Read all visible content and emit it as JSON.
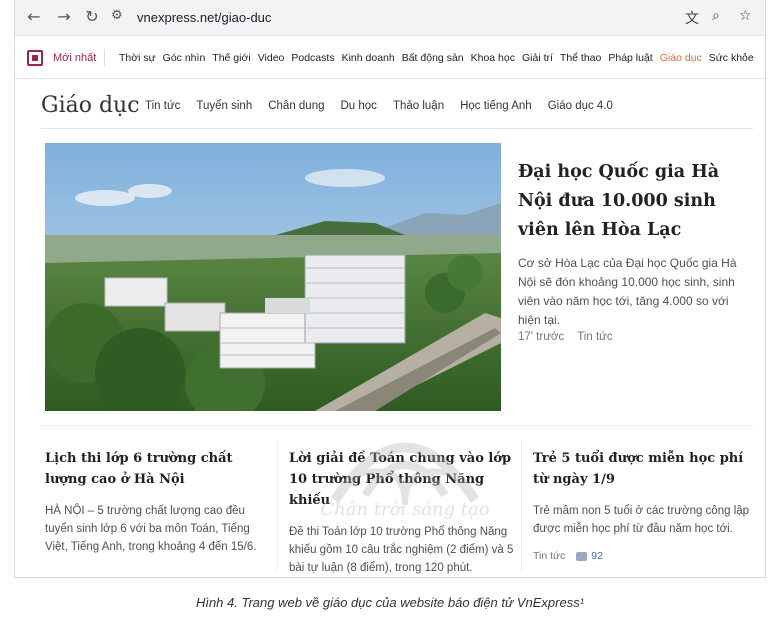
{
  "browser": {
    "url": "vnexpress.net/giao-duc",
    "back_icon": "arrow-left-icon",
    "forward_icon": "arrow-right-icon",
    "reload_icon": "reload-icon"
  },
  "topnav": {
    "latest": "Mới nhất",
    "items": [
      "Thời sự",
      "Góc nhìn",
      "Thế giới",
      "Video",
      "Podcasts",
      "Kinh doanh",
      "Bất động sản",
      "Khoa học",
      "Giải trí",
      "Thể thao",
      "Pháp luật",
      "Giáo dục",
      "Sức khỏe"
    ],
    "active": "Giáo dục"
  },
  "section": {
    "title": "Giáo dục",
    "subnav": [
      "Tin tức",
      "Tuyển sinh",
      "Chân dung",
      "Du học",
      "Thảo luận",
      "Học tiếng Anh",
      "Giáo dục 4.0"
    ]
  },
  "featured": {
    "title": "Đại học Quốc gia Hà Nội đưa 10.000 sinh viên lên Hòa Lạc",
    "description": "Cơ sở Hòa Lạc của Đại học Quốc gia Hà Nội sẽ đón khoảng 10.000 học sinh, sinh viên vào năm học tới, tăng 4.000 so với hiện tại.",
    "time": "17' trước",
    "category": "Tin tức"
  },
  "articles": [
    {
      "title": "Lịch thi lớp 6 trường chất lượng cao ở Hà Nội",
      "description": "HÀ NỘI – 5 trường chất lượng cao đều tuyển sinh lớp 6 với ba môn Toán, Tiếng Việt, Tiếng Anh, trong khoảng 4 đến 15/6."
    },
    {
      "title": "Lời giải đề Toán chung vào lớp 10 trường Phổ thông Năng khiếu",
      "description": "Đề thi Toán lớp 10 trường Phổ thông Năng khiếu gồm 10 câu trắc nghiệm (2 điểm) và 5 bài tự luận (8 điểm), trong 120 phút."
    },
    {
      "title": "Trẻ 5 tuổi được miễn học phí từ ngày 1/9",
      "description": "Trẻ mầm non 5 tuổi ở các trường công lập được miễn học phí từ đầu năm học tới.",
      "category": "Tin tức",
      "comments": "92"
    }
  ],
  "watermark": "Chân trời sáng tạo",
  "caption": "Hình 4. Trang web về giáo dục của website báo điện tử VnExpress¹",
  "colors": {
    "brand": "#9f224e",
    "active": "#e06a3a",
    "comment": "#4a6ea9"
  }
}
